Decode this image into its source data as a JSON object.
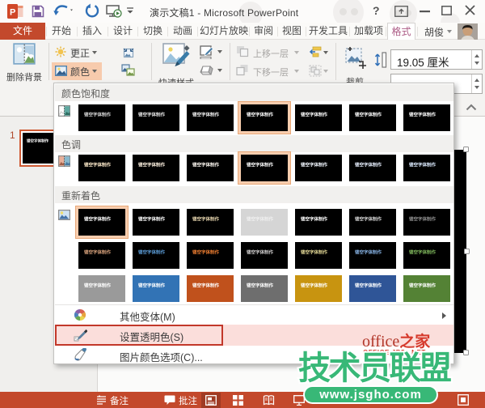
{
  "titlebar": {
    "title": "演示文稿1 - Microsoft PowerPoint",
    "help": "?"
  },
  "tabs": {
    "file": "文件",
    "items": [
      "开始",
      "插入",
      "设计",
      "切换",
      "动画",
      "幻灯片放映",
      "审阅",
      "视图",
      "开发工具",
      "加载项"
    ],
    "active": "格式",
    "account": "胡俊"
  },
  "ribbon": {
    "remove_bg": "删除背景",
    "corrections": "更正",
    "color": "颜色",
    "quick_styles": "快速样式",
    "bring_forward": "上移一层",
    "send_backward": "下移一层",
    "crop": "裁剪",
    "height_value": "19.05 厘米"
  },
  "slide_panel": {
    "slide_number": "1"
  },
  "picture_text": "镂空字体制作",
  "menu": {
    "sections": [
      {
        "title": "颜色饱和度",
        "rows": [
          [
            {
              "bg": "#000000",
              "fg": "#d7d7d7"
            },
            {
              "bg": "#000000",
              "fg": "#e5e5e5"
            },
            {
              "bg": "#000000",
              "fg": "#f2f2f2"
            },
            {
              "bg": "#000000",
              "fg": "#ffffff",
              "sel": true
            },
            {
              "bg": "#000000",
              "fg": "#ffffff"
            },
            {
              "bg": "#000000",
              "fg": "#ffffff"
            },
            {
              "bg": "#000000",
              "fg": "#ffffff"
            }
          ]
        ]
      },
      {
        "title": "色调",
        "rows": [
          [
            {
              "bg": "#000000",
              "fg": "#ffeccc"
            },
            {
              "bg": "#000000",
              "fg": "#fff3e2"
            },
            {
              "bg": "#000000",
              "fg": "#fffaf3"
            },
            {
              "bg": "#000000",
              "fg": "#ffffff",
              "sel": true
            },
            {
              "bg": "#000000",
              "fg": "#f2f7ff"
            },
            {
              "bg": "#000000",
              "fg": "#e8f0ff"
            },
            {
              "bg": "#000000",
              "fg": "#dcebff"
            }
          ]
        ]
      },
      {
        "title": "重新着色",
        "rows": [
          [
            {
              "bg": "#000000",
              "fg": "#ffffff",
              "sel": true
            },
            {
              "bg": "#000000",
              "fg": "#ffffff"
            },
            {
              "bg": "#000000",
              "fg": "#e6d5ae"
            },
            {
              "bg": "#d5d5d5",
              "fg": "#efefef"
            },
            {
              "bg": "#000000",
              "fg": "#ffffff"
            },
            {
              "bg": "#000000",
              "fg": "#d4d4d4"
            },
            {
              "bg": "#000000",
              "fg": "#8f8f8f"
            }
          ],
          [
            {
              "bg": "#000000",
              "fg": "#d8a27c"
            },
            {
              "bg": "#000000",
              "fg": "#5b9bd5"
            },
            {
              "bg": "#000000",
              "fg": "#ed7d31"
            },
            {
              "bg": "#000000",
              "fg": "#d0cece"
            },
            {
              "bg": "#000000",
              "fg": "#e2d795"
            },
            {
              "bg": "#000000",
              "fg": "#86b1e2"
            },
            {
              "bg": "#000000",
              "fg": "#7fb75c"
            }
          ],
          [
            {
              "bg": "#9a9a9a",
              "fg": "#ffffff"
            },
            {
              "bg": "#3273b5",
              "fg": "#ffffff"
            },
            {
              "bg": "#c0511c",
              "fg": "#ffffff"
            },
            {
              "bg": "#6e6e6e",
              "fg": "#ffffff"
            },
            {
              "bg": "#c89410",
              "fg": "#ffffff"
            },
            {
              "bg": "#2f5597",
              "fg": "#ffffff"
            },
            {
              "bg": "#548235",
              "fg": "#ffffff"
            }
          ]
        ]
      }
    ],
    "items": {
      "more_variations": "其他变体(M)",
      "set_transparent": "设置透明色(S)",
      "picture_color_options": "图片颜色选项(C)..."
    }
  },
  "statusbar": {
    "notes": "备注",
    "comments": "批注"
  },
  "watermarks": {
    "office_home": {
      "brand": "office",
      "home": "之家",
      "sub": "OFFICE.JB51.NET"
    },
    "league": {
      "title": "技术员联盟",
      "url": "www.jsgho.com"
    }
  },
  "colors": {
    "chrome_red": "#c3492c",
    "highlight_peach": "#f7cbad",
    "selection_orange": "#e8a878",
    "annotation_red": "#c2382a",
    "league_green": "#38b877"
  }
}
